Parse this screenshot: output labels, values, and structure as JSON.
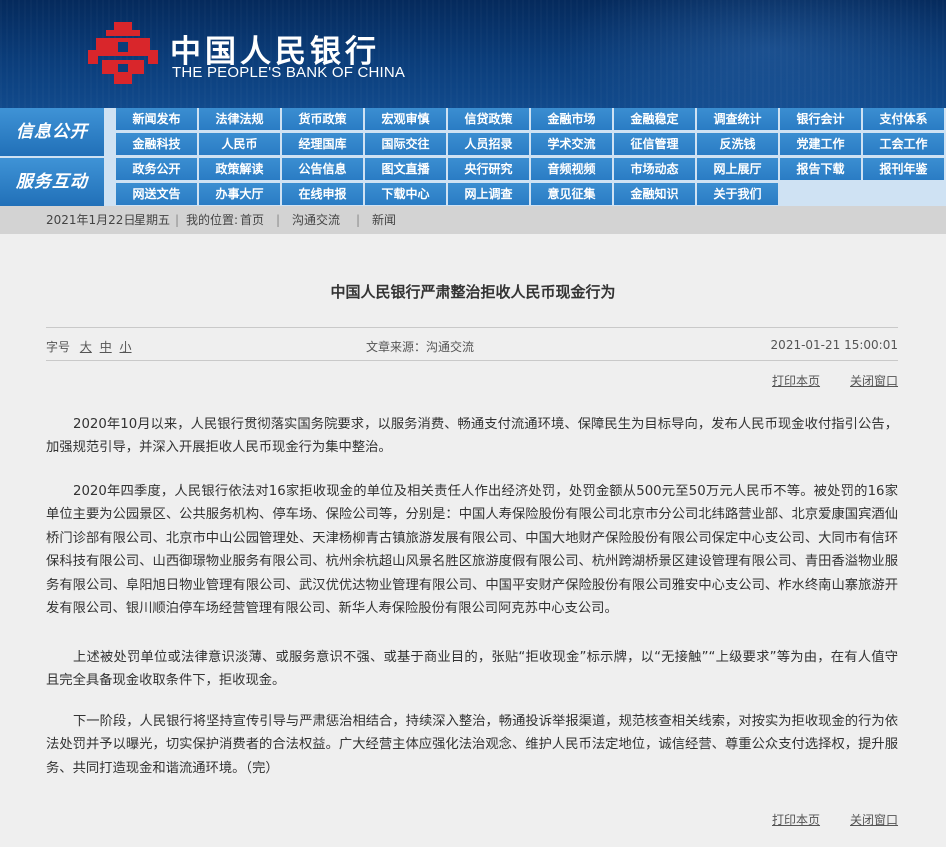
{
  "header": {
    "bank_name_cn": "中国人民银行",
    "bank_name_en": "THE PEOPLE'S BANK OF CHINA",
    "logo_icon": "pboc-logo-icon",
    "colors": {
      "banner": "#0b3d7a",
      "logo": "#d9262b",
      "nav_item": "#2a7cc4",
      "nav_bg": "#cfe2f3"
    }
  },
  "nav": {
    "info_title": "信息公开",
    "info_items": [
      "新闻发布",
      "法律法规",
      "货币政策",
      "宏观审慎",
      "信贷政策",
      "金融市场",
      "金融稳定",
      "调查统计",
      "银行会计",
      "支付体系",
      "金融科技",
      "人民币",
      "经理国库",
      "国际交往",
      "人员招录",
      "学术交流",
      "征信管理",
      "反洗钱",
      "党建工作",
      "工会工作"
    ],
    "interact_title": "服务互动",
    "interact_items": [
      "政务公开",
      "政策解读",
      "公告信息",
      "图文直播",
      "央行研究",
      "音频视频",
      "市场动态",
      "网上展厅",
      "报告下载",
      "报刊年鉴",
      "网送文告",
      "办事大厅",
      "在线申报",
      "下载中心",
      "网上调查",
      "意见征集",
      "金融知识",
      "关于我们"
    ]
  },
  "breadcrumb": {
    "date": "2021年1月22日",
    "weekday": "星期五",
    "location_label": "我的位置:",
    "home": "首页",
    "section": "沟通交流",
    "current": "新闻"
  },
  "article": {
    "title": "中国人民银行严肃整治拒收人民币现金行为",
    "font_size_label": "字号",
    "font_large": "大",
    "font_medium": "中",
    "font_small": "小",
    "source": "文章来源：沟通交流",
    "datetime": "2021-01-21  15:00:01",
    "print_label": "打印本页",
    "close_label": "关闭窗口",
    "paragraphs": [
      "2020年10月以来，人民银行贯彻落实国务院要求，以服务消费、畅通支付流通环境、保障民生为目标导向，发布人民币现金收付指引公告，加强规范引导，并深入开展拒收人民币现金行为集中整治。",
      "2020年四季度，人民银行依法对16家拒收现金的单位及相关责任人作出经济处罚，处罚金额从500元至50万元人民币不等。被处罚的16家单位主要为公园景区、公共服务机构、停车场、保险公司等，分别是：中国人寿保险股份有限公司北京市分公司北纬路营业部、北京爱康国宾酒仙桥门诊部有限公司、北京市中山公园管理处、天津杨柳青古镇旅游发展有限公司、中国大地财产保险股份有限公司保定中心支公司、大同市有信环保科技有限公司、山西御璟物业服务有限公司、杭州余杭超山风景名胜区旅游度假有限公司、杭州跨湖桥景区建设管理有限公司、青田香溢物业服务有限公司、阜阳旭日物业管理有限公司、武汉优优达物业管理有限公司、中国平安财产保险股份有限公司雅安中心支公司、柞水终南山寨旅游开发有限公司、银川顺泊停车场经营管理有限公司、新华人寿保险股份有限公司阿克苏中心支公司。",
      "上述被处罚单位或法律意识淡薄、或服务意识不强、或基于商业目的，张贴“拒收现金”标示牌，以“无接触”“上级要求”等为由，在有人值守且完全具备现金收取条件下，拒收现金。",
      "下一阶段，人民银行将坚持宣传引导与严肃惩治相结合，持续深入整治，畅通投诉举报渠道，规范核查相关线索，对按实为拒收现金的行为依法处罚并予以曝光，切实保护消费者的合法权益。广大经营主体应强化法治观念、维护人民币法定地位，诚信经营、尊重公众支付选择权，提升服务、共同打造现金和谐流通环境。（完）"
    ]
  }
}
